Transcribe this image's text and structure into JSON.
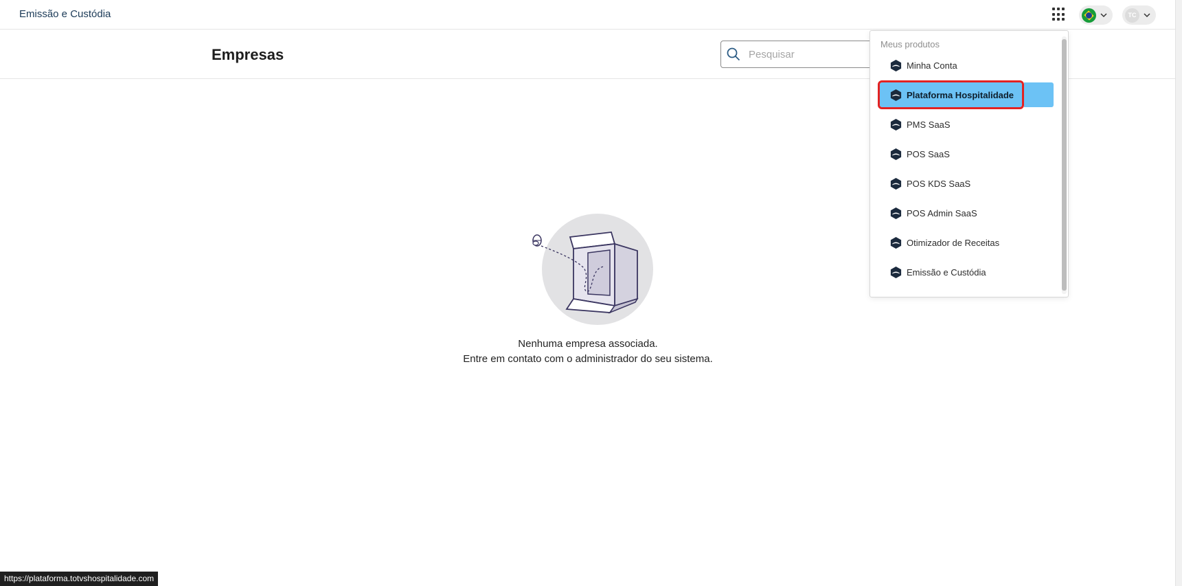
{
  "topbar": {
    "app_title": "Emissão e Custódia",
    "user_initials": "TC"
  },
  "header": {
    "page_title": "Empresas",
    "search_placeholder": "Pesquisar"
  },
  "empty_state": {
    "line1": "Nenhuma empresa associada.",
    "line2": "Entre em contato com o administrador do seu sistema."
  },
  "products_menu": {
    "title": "Meus produtos",
    "items": [
      {
        "label": "Minha Conta"
      },
      {
        "label": "Plataforma Hospitalidade"
      },
      {
        "label": "PMS SaaS"
      },
      {
        "label": "POS SaaS"
      },
      {
        "label": "POS KDS SaaS"
      },
      {
        "label": "POS Admin SaaS"
      },
      {
        "label": "Otimizador de Receitas"
      },
      {
        "label": "Emissão e Custódia"
      }
    ],
    "active_index": 1
  },
  "status_bar": {
    "url": "https://plataforma.totvshospitalidade.com"
  },
  "colors": {
    "accent": "#6cc2f5",
    "highlight_border": "#e32222",
    "title_color": "#1b3a57"
  },
  "icons": [
    "apps-grid-icon",
    "brazil-flag-icon",
    "chevron-down-icon",
    "search-icon",
    "product-logo-icon",
    "empty-box-illustration"
  ]
}
